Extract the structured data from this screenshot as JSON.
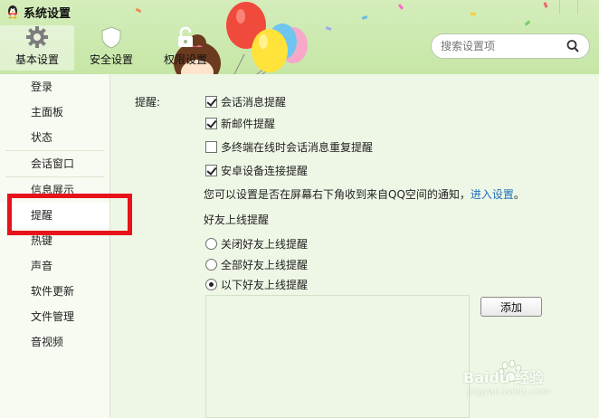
{
  "window": {
    "title": "系统设置"
  },
  "tabs": [
    {
      "label": "基本设置",
      "icon": "gear-icon",
      "active": true
    },
    {
      "label": "安全设置",
      "icon": "shield-icon",
      "active": false
    },
    {
      "label": "权限设置",
      "icon": "lock-icon",
      "active": false
    }
  ],
  "search": {
    "placeholder": "搜索设置项",
    "icon": "search-icon"
  },
  "sidebar": {
    "items": [
      {
        "label": "登录"
      },
      {
        "label": "主面板"
      },
      {
        "label": "状态"
      },
      {
        "label": "会话窗口"
      },
      {
        "label": "信息展示"
      },
      {
        "label": "提醒",
        "selected": true
      },
      {
        "label": "热键"
      },
      {
        "label": "声音"
      },
      {
        "label": "软件更新"
      },
      {
        "label": "文件管理"
      },
      {
        "label": "音视频"
      }
    ]
  },
  "reminders": {
    "section_label": "提醒:",
    "options": [
      {
        "label": "会话消息提醒",
        "checked": true
      },
      {
        "label": "新邮件提醒",
        "checked": true
      },
      {
        "label": "多终端在线时会话消息重复提醒",
        "checked": false
      },
      {
        "label": "安卓设备连接提醒",
        "checked": true
      }
    ],
    "notice_text": "您可以设置是否在屏幕右下角收到来自QQ空间的通知，",
    "notice_link": "进入设置",
    "notice_end": "。"
  },
  "friend_online": {
    "title": "好友上线提醒",
    "options": [
      {
        "label": "关闭好友上线提醒",
        "selected": false
      },
      {
        "label": "全部好友上线提醒",
        "selected": false
      },
      {
        "label": "以下好友上线提醒",
        "selected": true
      }
    ],
    "add_button": "添加"
  },
  "watermark": {
    "text": "Baidu 经验",
    "sub": "jingyan.baidu.com"
  },
  "colors": {
    "header_bg": "#c6e6a6",
    "link": "#1f6fb8",
    "highlight": "#e8121a"
  }
}
